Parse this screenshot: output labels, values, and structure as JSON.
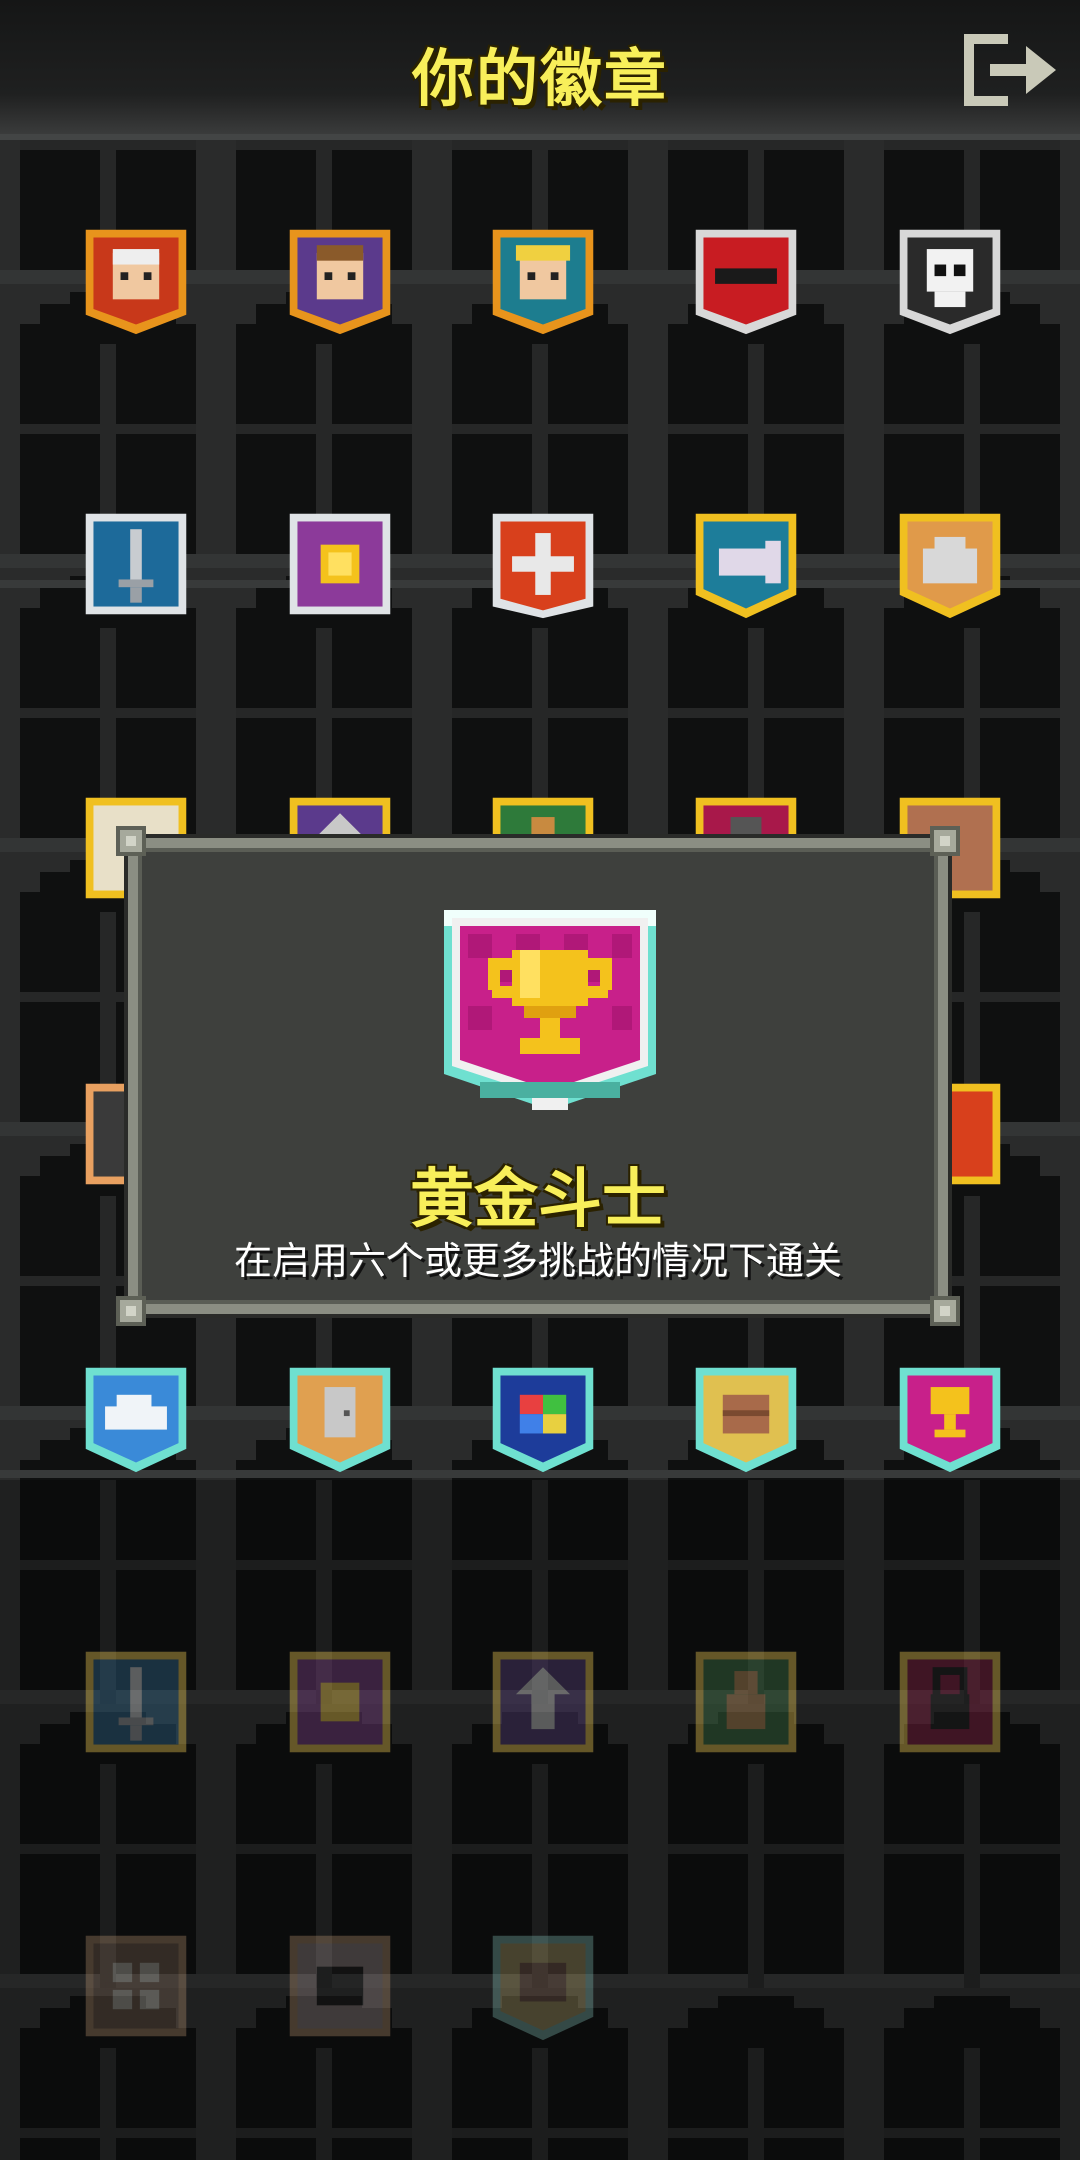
{
  "header": {
    "title": "你的徽章",
    "exit_icon": "exit-icon"
  },
  "colors": {
    "title_yellow": "#f8ef5a",
    "modal_border": "#8b8e83",
    "modal_bg": "#3e403d"
  },
  "badges": {
    "rows": [
      [
        "warrior-portrait-badge",
        "mage-portrait-badge",
        "huntress-portrait-badge",
        "rogue-mask-badge",
        "skull-badge"
      ],
      [
        "sword-badge",
        "gold-coin-badge",
        "bonus-health-badge",
        "fish-badge",
        "chest-badge"
      ],
      [
        "scroll-badge",
        "up-arrow-badge",
        "pawn-badge",
        "lock-badge",
        "shield-badge"
      ],
      [
        "bomb-badge",
        "hidden-badge",
        "hidden-badge",
        "hidden-badge",
        "ring-badge"
      ],
      [
        "cloud-badge",
        "door-badge",
        "rainbow-badge",
        "chest-badge",
        "trophy-badge"
      ],
      [
        "sword-badge",
        "gold-coin-badge",
        "up-arrow-badge",
        "pawn-badge",
        "lock-badge"
      ],
      [
        "grid-badge",
        "bomb-badge",
        "chest-badge"
      ]
    ]
  },
  "modal": {
    "badge_icon": "trophy-badge",
    "title": "黄金斗士",
    "description": "在启用六个或更多挑战的情况下通关"
  }
}
